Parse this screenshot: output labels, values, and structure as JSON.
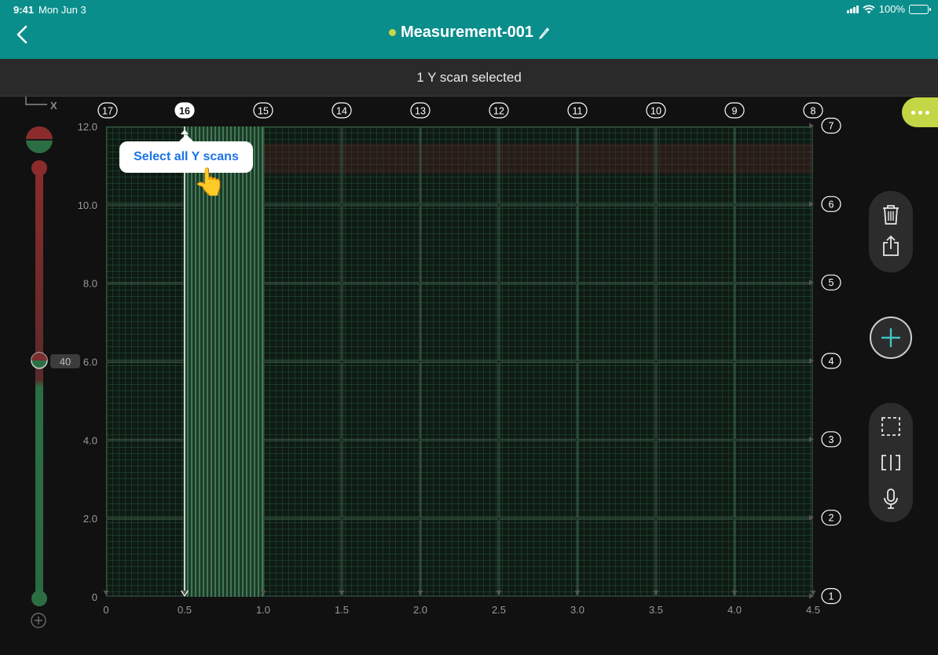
{
  "status_bar": {
    "time": "9:41",
    "date": "Mon Jun 3",
    "battery": "100%"
  },
  "header": {
    "title": "Measurement-001"
  },
  "selection_bar": {
    "text": "1 Y scan selected"
  },
  "axis": {
    "x_corner_label": "X"
  },
  "tooltip": {
    "label": "Select all Y scans"
  },
  "depth_slider": {
    "value": "40"
  },
  "colors": {
    "header": "#0a8e8c",
    "accent": "#c3d645",
    "tooltip_text": "#1a73e8",
    "grid_green": "#2e8c55",
    "selected_scan": "#7fe0a0"
  },
  "chart_data": {
    "type": "heatmap",
    "x_ticks": [
      "0",
      "0.5",
      "1.0",
      "1.5",
      "2.0",
      "2.5",
      "3.0",
      "3.5",
      "4.0",
      "4.5"
    ],
    "y_ticks": [
      "0",
      "2.0",
      "4.0",
      "6.0",
      "8.0",
      "10.0",
      "12.0"
    ],
    "xlim": [
      0,
      4.5
    ],
    "ylim": [
      0,
      12.0
    ],
    "y_scans": [
      "17",
      "16",
      "15",
      "14",
      "13",
      "12",
      "11",
      "10",
      "9",
      "8"
    ],
    "x_scans": [
      "1",
      "2",
      "3",
      "4",
      "5",
      "6",
      "7"
    ],
    "selected_y_scan": "16",
    "selected_x_range": [
      0.5,
      1.0
    ]
  }
}
